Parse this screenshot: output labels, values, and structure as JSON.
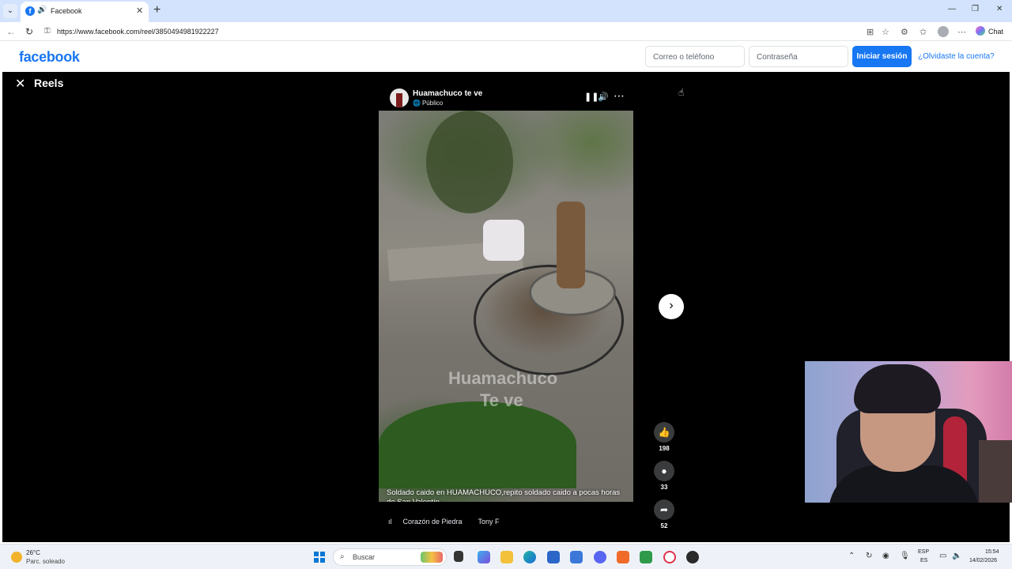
{
  "browser": {
    "tab_title": "Facebook",
    "url": "https://www.facebook.com/reel/3850494981922227",
    "chat_label": "Chat"
  },
  "fb_header": {
    "logo": "facebook",
    "email_placeholder": "Correo o teléfono",
    "password_placeholder": "Contraseña",
    "login_button": "Iniciar sesión",
    "forgot_link": "¿Olvidaste la cuenta?"
  },
  "reels": {
    "title": "Reels",
    "author": {
      "name": "Huamachuco te ve",
      "audience": "Público"
    },
    "video": {
      "watermark_line1": "Huamachuco",
      "watermark_line2": "Te ve",
      "caption": "Soldado caido en HUAMACHUCO,repito soldado caido a pocas horas de San Valentín."
    },
    "music": {
      "song": "Corazón de Piedra",
      "artist": "Tony F"
    },
    "actions": {
      "likes": "198",
      "comments": "33",
      "shares": "52"
    },
    "icons": [
      "close-icon",
      "pause-icon",
      "volume-icon",
      "more-icon",
      "chevron-right-icon",
      "like-icon",
      "comment-icon",
      "share-icon"
    ]
  },
  "taskbar": {
    "temperature": "26°C",
    "weather": "Parc. soleado",
    "search_label": "Buscar",
    "lang_top": "ESP",
    "lang_bottom": "ES",
    "time": "15:54",
    "date": "14/02/2026"
  },
  "colors": {
    "fb_blue": "#1877f2",
    "reels_bg": "#000000",
    "tab_strip": "#d3e3fd"
  }
}
